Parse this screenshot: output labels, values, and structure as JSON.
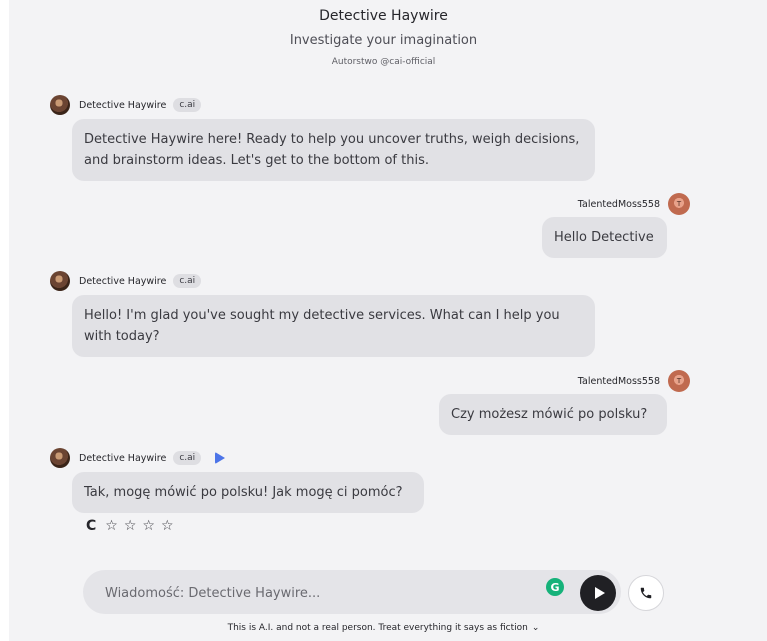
{
  "header": {
    "title": "Detective Haywire",
    "subtitle": "Investigate your imagination",
    "author": "Autorstwo @cai-official"
  },
  "messages": [
    {
      "role": "bot",
      "name": "Detective Haywire",
      "badge": "c.ai",
      "text": "Detective Haywire here! Ready to help you uncover truths, weigh decisions, and brainstorm ideas. Let's get to the bottom of this."
    },
    {
      "role": "user",
      "name": "TalentedMoss558",
      "avatar_letter": "T",
      "text": "Hello Detective"
    },
    {
      "role": "bot",
      "name": "Detective Haywire",
      "badge": "c.ai",
      "text": "Hello! I'm glad you've sought my detective services. What can I help you with today?"
    },
    {
      "role": "user",
      "name": "TalentedMoss558",
      "avatar_letter": "T",
      "text": "Czy możesz mówić po polsku?"
    },
    {
      "role": "bot",
      "name": "Detective Haywire",
      "badge": "c.ai",
      "text": "Tak, mogę mówić po polsku! Jak mogę ci pomóc?"
    }
  ],
  "actions": {
    "regenerate_icon": "refresh-icon",
    "rating_stars": 4,
    "rating_value": 0
  },
  "composer": {
    "placeholder": "Wiadomość: Detective Haywire...",
    "value": ""
  },
  "disclaimer": "This is A.I. and not a real person. Treat everything it says as fiction",
  "colors": {
    "background": "#f3f3f5",
    "bubble": "#e1e1e5",
    "send_button": "#202024",
    "grammarly": "#16b27a",
    "play_accent": "#4c74e8"
  }
}
